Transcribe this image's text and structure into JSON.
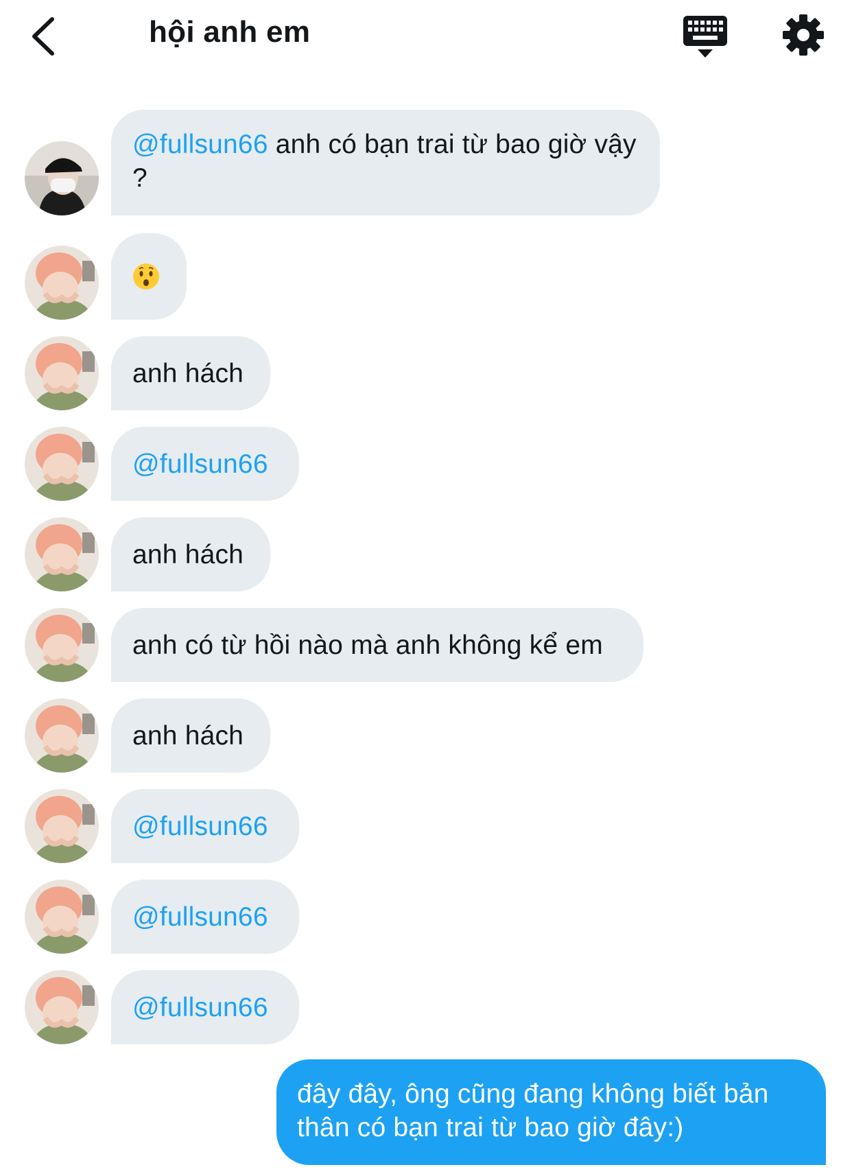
{
  "header": {
    "title": "hội anh em",
    "back_icon": "chevron-left-icon",
    "keyboard_icon": "keyboard-icon",
    "settings_icon": "gear-icon"
  },
  "colors": {
    "mention": "#1da1f2",
    "received_bubble": "#e6ecf0",
    "sent_bubble": "#1da1f2"
  },
  "messages": [
    {
      "sender": "other-a",
      "mention": "@fullsun66",
      "text": " anh có bạn trai từ bao giờ vậy ?"
    },
    {
      "sender": "other-b",
      "emoji": "hushed-face-emoji"
    },
    {
      "sender": "other-b",
      "text": "anh hách"
    },
    {
      "sender": "other-b",
      "mention": "@fullsun66"
    },
    {
      "sender": "other-b",
      "text": "anh hách"
    },
    {
      "sender": "other-b",
      "text": "anh có từ hồi nào mà anh không kể em"
    },
    {
      "sender": "other-b",
      "text": "anh hách"
    },
    {
      "sender": "other-b",
      "mention": "@fullsun66"
    },
    {
      "sender": "other-b",
      "mention": "@fullsun66"
    },
    {
      "sender": "other-b",
      "mention": "@fullsun66"
    }
  ],
  "my_message": {
    "text": "đây đây, ông cũng đang không biết bản thân có bạn trai từ bao giờ đây:)"
  }
}
